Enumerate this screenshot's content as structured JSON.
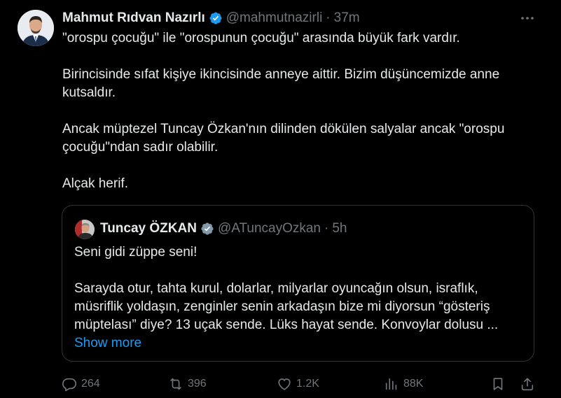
{
  "tweet": {
    "author_name": "Mahmut Rıdvan Nazırlı",
    "author_handle": "@mahmutnazirli",
    "separator": "·",
    "time": "37m",
    "paragraphs": [
      "\"orospu çocuğu\" ile \"orospunun çocuğu\" arasında büyük fark vardır.",
      "Birincisinde sıfat kişiye ikincisinde anneye aittir. Bizim düşüncemizde anne kutsaldır.",
      "Ancak müptezel Tuncay Özkan'nın dilinden dökülen salyalar ancak \"orospu çocuğu\"ndan sadır olabilir.",
      "Alçak herif."
    ]
  },
  "quote": {
    "author_name": "Tuncay ÖZKAN",
    "author_handle": "@ATuncayOzkan",
    "separator": "·",
    "time": "5h",
    "paragraphs": [
      "Seni gidi züppe seni!",
      "Sarayda otur, tahta kurul, dolarlar, milyarlar oyuncağın olsun, israflık, müsriflik yoldaşın, zenginler senin arkadaşın bize mi diyorsun “gösteriş müptelası” diye? 13 uçak sende. Lüks hayat sende. Konvoylar dolusu ..."
    ],
    "show_more": "Show more"
  },
  "actions": {
    "replies": "264",
    "reposts": "396",
    "likes": "1.2K",
    "views": "88K"
  },
  "colors": {
    "background": "#000000",
    "text": "#e7e9ea",
    "muted": "#71767b",
    "accent": "#1d9bf0",
    "border": "#2f3336",
    "verified_blue": "#1d9bf0",
    "verified_gray": "#829aab"
  },
  "icons": {
    "verified": "verified-badge-icon",
    "more": "more-horizontal-icon",
    "reply": "reply-icon",
    "repost": "repost-icon",
    "like": "heart-icon",
    "views": "bar-chart-icon",
    "bookmark": "bookmark-icon",
    "share": "share-icon"
  }
}
